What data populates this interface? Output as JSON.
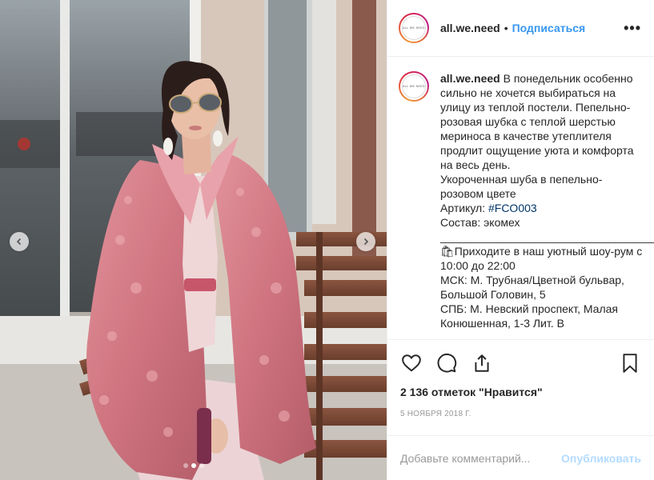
{
  "post": {
    "username": "all.we.need",
    "separator": "•",
    "follow_label": "Подписаться",
    "more_icon": "more-horizontal-icon",
    "avatar_logo_text": "ALL WE NEED",
    "caption": {
      "username": "all.we.need",
      "text_1": " В понедельник особенно сильно не хочется выбираться на улицу из теплой постели. Пепельно-розовая шубка с теплой шерстью мериноса в качестве утеплителя продлит ощущение уюта и комфорта на весь день.\nУкороченная шуба в пепельно-розовом цвете\nАртикул: ",
      "hashtag": "#FCO003",
      "text_2": "\nСостав: экомех\n",
      "rule": "_______________________________________",
      "text_3": "\n🛍Приходите в наш уютный шоу-рум с 10:00 до 22:00\nМСК: М. Трубная/Цветной бульвар, Большой Головин, 5\nСПБ: М. Невский проспект, Малая Конюшенная, 1-3 Лит. В"
    },
    "actions": {
      "like_icon": "heart-icon",
      "comment_icon": "comment-icon",
      "share_icon": "share-icon",
      "save_icon": "bookmark-icon"
    },
    "likes_text": "2 136 отметок \"Нравится\"",
    "date_text": "5 НОЯБРЯ 2018 Г.",
    "comment_placeholder": "Добавьте комментарий...",
    "publish_label": "Опубликовать"
  },
  "carousel": {
    "total": 3,
    "current": 2,
    "prev_icon": "chevron-left-icon",
    "next_icon": "chevron-right-icon"
  },
  "colors": {
    "link_blue": "#3897f0",
    "publish_disabled": "#b3dbff",
    "coat_pink": "#d9808c",
    "hashtag": "#003569"
  }
}
